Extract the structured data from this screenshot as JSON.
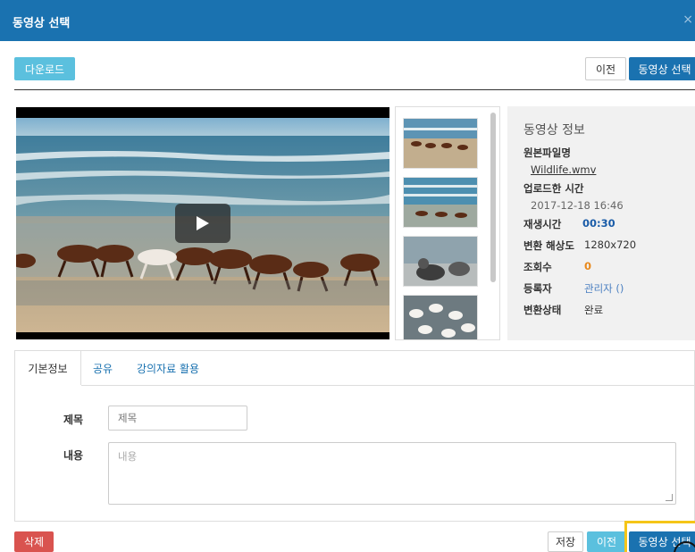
{
  "dialog": {
    "title": "동영상 선택",
    "close": "×"
  },
  "toolbar": {
    "download": "다운로드",
    "prev": "이전",
    "select": "동영상 선택"
  },
  "player": {
    "play": "play-icon"
  },
  "info": {
    "heading": "동영상 정보",
    "original_file_label": "원본파일명",
    "original_file": "Wildlife.wmv",
    "upload_time_label": "업로드한 시간",
    "upload_time": "2017-12-18 16:46",
    "duration_label": "재생시간",
    "duration": "00:30",
    "resolution_label": "변환 해상도",
    "resolution": "1280x720",
    "views_label": "조회수",
    "views": "0",
    "uploader_label": "등록자",
    "uploader": "관리자 ()",
    "status_label": "변환상태",
    "status": "완료"
  },
  "tabs": {
    "basic": "기본정보",
    "share": "공유",
    "lecture": "강의자료 활용"
  },
  "form": {
    "title_label": "제목",
    "title_placeholder": "제목",
    "content_label": "내용",
    "content_placeholder": "내용"
  },
  "footer": {
    "delete": "삭제",
    "save": "저장",
    "prev": "이전",
    "select": "동영상 선택"
  },
  "colors": {
    "primary": "#1a72b0",
    "info": "#5bc0de",
    "danger": "#d9534f",
    "highlight": "#f5c518"
  }
}
